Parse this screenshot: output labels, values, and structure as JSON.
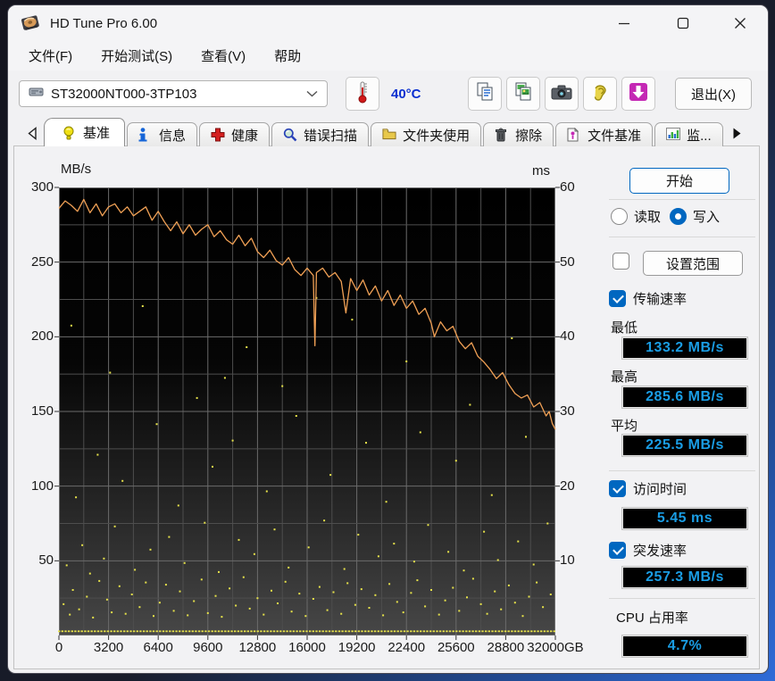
{
  "window": {
    "title": "HD Tune Pro 6.00"
  },
  "menu": {
    "items": [
      "文件(F)",
      "开始测试(S)",
      "查看(V)",
      "帮助"
    ]
  },
  "toolbar": {
    "drive": "ST32000NT000-3TP103",
    "temperature": "40°C",
    "exit_label": "退出(X)",
    "icons": [
      "thermometer-icon",
      "copy-text-icon",
      "copy-image-icon",
      "camera-icon",
      "ear-icon",
      "download-icon"
    ]
  },
  "tabs": {
    "items": [
      {
        "label": "基准",
        "icon": "bulb-icon",
        "active": true
      },
      {
        "label": "信息",
        "icon": "info-icon",
        "active": false
      },
      {
        "label": "健康",
        "icon": "health-icon",
        "active": false
      },
      {
        "label": "错误扫描",
        "icon": "scan-icon",
        "active": false
      },
      {
        "label": "文件夹使用",
        "icon": "folder-icon",
        "active": false
      },
      {
        "label": "擦除",
        "icon": "erase-icon",
        "active": false
      },
      {
        "label": "文件基准",
        "icon": "file-benchmark-icon",
        "active": false
      },
      {
        "label": "监...",
        "icon": "monitor-icon",
        "active": false
      }
    ]
  },
  "side": {
    "start_label": "开始",
    "read_label": "读取",
    "write_label": "写入",
    "write_selected": true,
    "range_checked": false,
    "range_label": "设置范围",
    "transfer_label": "传输速率",
    "transfer_checked": true,
    "min_label": "最低",
    "min_value": "133.2 MB/s",
    "max_label": "最高",
    "max_value": "285.6 MB/s",
    "avg_label": "平均",
    "avg_value": "225.5 MB/s",
    "access_label": "访问时间",
    "access_checked": true,
    "access_value": "5.45 ms",
    "burst_label": "突发速率",
    "burst_checked": true,
    "burst_value": "257.3 MB/s",
    "cpu_label": "CPU 占用率",
    "cpu_value": "4.7%"
  },
  "colors": {
    "accent": "#0067c0",
    "lcd_text": "#1a9de4",
    "temperature_text": "#0a2fd0",
    "plot_line": "#f0a055",
    "plot_dots": "#e6e24a",
    "grid_major": "#6b6b6b",
    "grid_minor": "#4e4e4e"
  },
  "chart_data": {
    "type": "line",
    "title": "",
    "y_left": {
      "label": "MB/s",
      "min": 0,
      "max": 300,
      "ticks": [
        300,
        250,
        200,
        150,
        100,
        50
      ]
    },
    "y_right": {
      "label": "ms",
      "min": 0,
      "max": 60,
      "ticks": [
        60,
        50,
        40,
        30,
        20,
        10
      ]
    },
    "x": {
      "min": 0,
      "max": 32000,
      "unit": "GB",
      "tick_values": [
        0,
        3200,
        6400,
        9600,
        12800,
        16000,
        19200,
        22400,
        25600,
        28800,
        32000
      ],
      "tick_labels": [
        "0",
        "3200",
        "6400",
        "9600",
        "12800",
        "16000",
        "19200",
        "22400",
        "25600",
        "28800",
        "32000GB"
      ]
    },
    "grid": {
      "x_minor_gb": 1600,
      "y_minor_mbps": 25,
      "grid_on": true
    },
    "transfer_series": {
      "name": "传输速率",
      "unit": "MB/s",
      "color": "#f0a055",
      "points": [
        [
          0,
          286
        ],
        [
          400,
          291
        ],
        [
          800,
          288
        ],
        [
          1200,
          284
        ],
        [
          1600,
          292
        ],
        [
          2000,
          283
        ],
        [
          2400,
          289
        ],
        [
          2800,
          281
        ],
        [
          3200,
          287
        ],
        [
          3600,
          289
        ],
        [
          4000,
          283
        ],
        [
          4400,
          287
        ],
        [
          4800,
          281
        ],
        [
          5200,
          284
        ],
        [
          5600,
          287
        ],
        [
          6000,
          278
        ],
        [
          6400,
          284
        ],
        [
          6800,
          277
        ],
        [
          7200,
          271
        ],
        [
          7600,
          277
        ],
        [
          8000,
          269
        ],
        [
          8400,
          275
        ],
        [
          8800,
          268
        ],
        [
          9200,
          272
        ],
        [
          9600,
          275
        ],
        [
          10000,
          267
        ],
        [
          10400,
          271
        ],
        [
          10800,
          265
        ],
        [
          11200,
          262
        ],
        [
          11600,
          268
        ],
        [
          12000,
          261
        ],
        [
          12400,
          266
        ],
        [
          12800,
          257
        ],
        [
          13200,
          253
        ],
        [
          13600,
          258
        ],
        [
          14000,
          251
        ],
        [
          14400,
          248
        ],
        [
          14800,
          253
        ],
        [
          15200,
          245
        ],
        [
          15600,
          241
        ],
        [
          16000,
          246
        ],
        [
          16400,
          241
        ],
        [
          16500,
          194
        ],
        [
          16600,
          243
        ],
        [
          17000,
          246
        ],
        [
          17400,
          240
        ],
        [
          17800,
          243
        ],
        [
          18200,
          237
        ],
        [
          18500,
          216
        ],
        [
          18800,
          239
        ],
        [
          19200,
          231
        ],
        [
          19600,
          238
        ],
        [
          20000,
          228
        ],
        [
          20400,
          234
        ],
        [
          20800,
          224
        ],
        [
          21200,
          231
        ],
        [
          21600,
          221
        ],
        [
          22000,
          228
        ],
        [
          22400,
          219
        ],
        [
          22800,
          224
        ],
        [
          23200,
          215
        ],
        [
          23600,
          219
        ],
        [
          24000,
          209
        ],
        [
          24200,
          200
        ],
        [
          24600,
          210
        ],
        [
          25000,
          204
        ],
        [
          25400,
          207
        ],
        [
          25800,
          197
        ],
        [
          26200,
          192
        ],
        [
          26600,
          196
        ],
        [
          27000,
          187
        ],
        [
          27400,
          183
        ],
        [
          27800,
          178
        ],
        [
          28200,
          172
        ],
        [
          28600,
          176
        ],
        [
          29000,
          168
        ],
        [
          29400,
          162
        ],
        [
          29800,
          159
        ],
        [
          30200,
          161
        ],
        [
          30600,
          153
        ],
        [
          31000,
          156
        ],
        [
          31400,
          147
        ],
        [
          31600,
          150
        ],
        [
          31800,
          142
        ],
        [
          32000,
          138
        ]
      ]
    },
    "access_series": {
      "name": "访问时间",
      "unit": "ms",
      "color": "#e6e24a",
      "baseline_band": {
        "ms": 0.55,
        "step_gb": 210
      },
      "dots": [
        [
          300,
          4.2
        ],
        [
          700,
          2.8
        ],
        [
          900,
          6.1
        ],
        [
          1300,
          3.5
        ],
        [
          1800,
          5.2
        ],
        [
          2200,
          2.4
        ],
        [
          2600,
          7.3
        ],
        [
          3100,
          4.8
        ],
        [
          3400,
          3.1
        ],
        [
          3900,
          6.6
        ],
        [
          4300,
          2.9
        ],
        [
          4700,
          5.5
        ],
        [
          5200,
          3.8
        ],
        [
          5600,
          7.1
        ],
        [
          6100,
          2.6
        ],
        [
          6500,
          4.4
        ],
        [
          6900,
          6.8
        ],
        [
          7400,
          3.3
        ],
        [
          7800,
          5.9
        ],
        [
          8300,
          2.7
        ],
        [
          8700,
          4.6
        ],
        [
          9200,
          7.5
        ],
        [
          9600,
          3.0
        ],
        [
          10100,
          5.3
        ],
        [
          10500,
          2.5
        ],
        [
          11000,
          6.3
        ],
        [
          11400,
          4.0
        ],
        [
          11900,
          7.8
        ],
        [
          12300,
          3.6
        ],
        [
          12800,
          5.0
        ],
        [
          13200,
          2.8
        ],
        [
          13700,
          6.0
        ],
        [
          14100,
          4.3
        ],
        [
          14600,
          7.2
        ],
        [
          15000,
          3.2
        ],
        [
          15500,
          5.6
        ],
        [
          15900,
          2.6
        ],
        [
          16400,
          4.9
        ],
        [
          16800,
          6.5
        ],
        [
          17300,
          3.4
        ],
        [
          17700,
          5.8
        ],
        [
          18200,
          2.9
        ],
        [
          18600,
          7.0
        ],
        [
          19100,
          4.1
        ],
        [
          19500,
          6.2
        ],
        [
          20000,
          3.7
        ],
        [
          20400,
          5.4
        ],
        [
          20900,
          2.7
        ],
        [
          21300,
          6.9
        ],
        [
          21800,
          4.5
        ],
        [
          22200,
          3.1
        ],
        [
          22700,
          5.7
        ],
        [
          23100,
          7.4
        ],
        [
          23600,
          3.9
        ],
        [
          24000,
          6.1
        ],
        [
          24500,
          2.8
        ],
        [
          24900,
          4.7
        ],
        [
          25400,
          6.4
        ],
        [
          25800,
          3.3
        ],
        [
          26300,
          5.1
        ],
        [
          26700,
          7.6
        ],
        [
          27200,
          4.2
        ],
        [
          27600,
          2.9
        ],
        [
          28100,
          5.9
        ],
        [
          28500,
          3.5
        ],
        [
          29000,
          6.7
        ],
        [
          29400,
          4.4
        ],
        [
          29900,
          2.6
        ],
        [
          30300,
          5.2
        ],
        [
          30800,
          7.1
        ],
        [
          31200,
          3.8
        ],
        [
          31700,
          5.5
        ],
        [
          500,
          9.4
        ],
        [
          1500,
          12.1
        ],
        [
          2900,
          10.3
        ],
        [
          3600,
          14.6
        ],
        [
          4900,
          8.8
        ],
        [
          5900,
          11.5
        ],
        [
          7100,
          13.2
        ],
        [
          8100,
          9.7
        ],
        [
          9400,
          15.1
        ],
        [
          10300,
          8.5
        ],
        [
          11600,
          12.8
        ],
        [
          12600,
          10.9
        ],
        [
          13900,
          14.2
        ],
        [
          14800,
          9.1
        ],
        [
          16100,
          11.8
        ],
        [
          17100,
          15.4
        ],
        [
          18400,
          8.9
        ],
        [
          19300,
          13.5
        ],
        [
          20600,
          10.6
        ],
        [
          21600,
          12.3
        ],
        [
          22900,
          9.9
        ],
        [
          23800,
          14.8
        ],
        [
          25100,
          11.2
        ],
        [
          26100,
          8.7
        ],
        [
          27400,
          13.9
        ],
        [
          28300,
          10.1
        ],
        [
          29600,
          12.6
        ],
        [
          30600,
          9.5
        ],
        [
          31500,
          15.0
        ],
        [
          2000,
          8.3
        ],
        [
          1100,
          18.5
        ],
        [
          2500,
          24.2
        ],
        [
          4100,
          20.7
        ],
        [
          6300,
          28.3
        ],
        [
          7700,
          17.4
        ],
        [
          9900,
          22.6
        ],
        [
          11200,
          26.1
        ],
        [
          13400,
          19.3
        ],
        [
          15300,
          29.4
        ],
        [
          17500,
          21.5
        ],
        [
          19800,
          25.8
        ],
        [
          21100,
          17.9
        ],
        [
          23300,
          27.2
        ],
        [
          25600,
          23.4
        ],
        [
          27900,
          18.8
        ],
        [
          30100,
          26.6
        ],
        [
          800,
          41.5
        ],
        [
          3300,
          35.2
        ],
        [
          5400,
          44.1
        ],
        [
          8900,
          31.8
        ],
        [
          12100,
          38.6
        ],
        [
          14400,
          33.4
        ],
        [
          18900,
          42.3
        ],
        [
          22400,
          36.7
        ],
        [
          26500,
          30.9
        ],
        [
          29200,
          39.8
        ],
        [
          16600,
          45.2
        ],
        [
          10700,
          34.5
        ]
      ]
    }
  }
}
